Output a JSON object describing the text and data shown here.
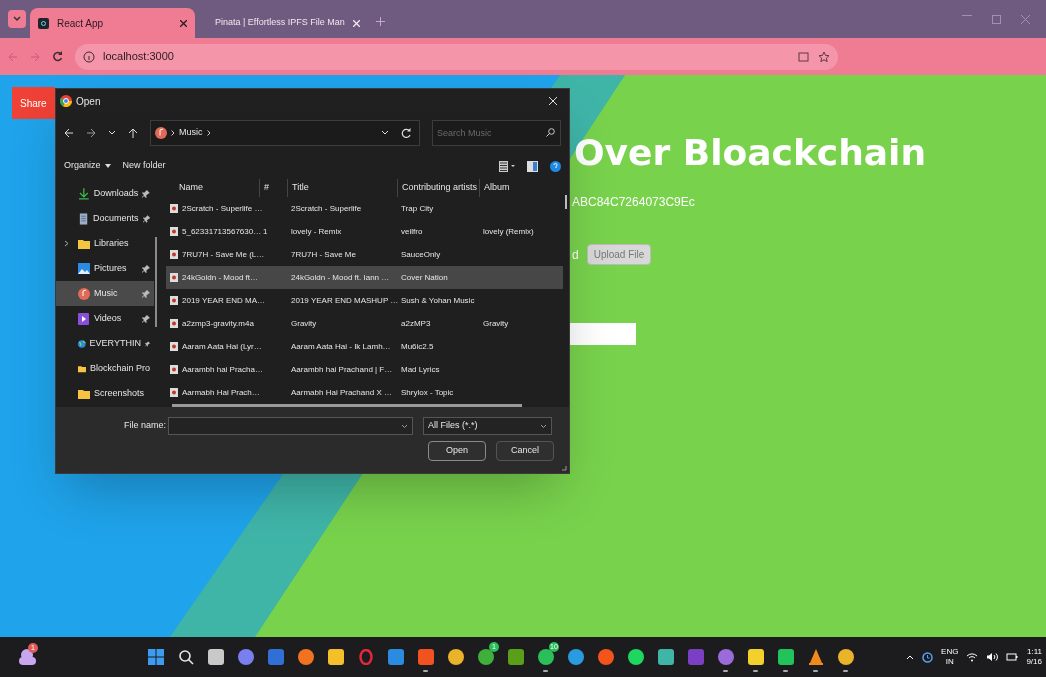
{
  "browser": {
    "tabs": [
      {
        "title": "React App",
        "selected": true
      },
      {
        "title": "Pinata | Effortless IPFS File Man",
        "selected": false
      }
    ],
    "address": "localhost:3000"
  },
  "page": {
    "share_button": "Share",
    "heading": "Over Bloackchain",
    "account": "ABC84C7264073C9Ec",
    "status_text": "d",
    "upload_button": "Upload File"
  },
  "dialog": {
    "title": "Open",
    "breadcrumb": "Music",
    "search_placeholder": "Search Music",
    "organize": "Organize",
    "new_folder": "New folder",
    "nav_items": [
      {
        "label": "Downloads",
        "kind": "download",
        "pinned": true,
        "selected": false
      },
      {
        "label": "Documents",
        "kind": "document",
        "pinned": true,
        "selected": false
      },
      {
        "label": "Libraries",
        "kind": "library",
        "pinned": false,
        "selected": false
      },
      {
        "label": "Pictures",
        "kind": "picture",
        "pinned": true,
        "selected": false
      },
      {
        "label": "Music",
        "kind": "music",
        "pinned": true,
        "selected": true
      },
      {
        "label": "Videos",
        "kind": "video",
        "pinned": true,
        "selected": false
      },
      {
        "label": "EVERYTHIN",
        "kind": "globe",
        "pinned": true,
        "selected": false
      },
      {
        "label": "Blockchain Pro",
        "kind": "folder",
        "pinned": false,
        "selected": false
      },
      {
        "label": "Screenshots",
        "kind": "folder",
        "pinned": false,
        "selected": false
      }
    ],
    "columns": [
      "Name",
      "#",
      "Title",
      "Contributing artists",
      "Album"
    ],
    "rows": [
      {
        "name": "2Scratch - Superlife …",
        "title": "2Scratch - Superlife",
        "artists": "Trap City",
        "selected": false
      },
      {
        "name": "5_62331713567630…",
        "number": "1",
        "title": "lovely - Remix",
        "artists": "veilfro",
        "album": "lovely (Remix)",
        "selected": false
      },
      {
        "name": "7RU7H - Save Me (L…",
        "title": "7RU7H - Save Me",
        "artists": "SauceOnly",
        "selected": false
      },
      {
        "name": "24kGoldn - Mood ft…",
        "title": "24kGoldn - Mood ft. Iann …",
        "artists": "Cover Nation",
        "selected": true
      },
      {
        "name": "2019 YEAR END MA…",
        "title": "2019 YEAR END MASHUP …",
        "artists": "Sush & Yohan Music",
        "selected": false
      },
      {
        "name": "a2zmp3-gravity.m4a",
        "title": "Gravity",
        "artists": "a2zMP3",
        "album": "Gravity",
        "selected": false
      },
      {
        "name": "Aaram Aata Hai (Lyr…",
        "title": "Aaram Aata Hai - Ik Lamh…",
        "artists": "Mu6ic2.5",
        "selected": false
      },
      {
        "name": "Aarambh hai Pracha…",
        "title": "Aarambh hai Prachand | F…",
        "artists": "Mad Lyrics",
        "selected": false
      },
      {
        "name": "Aarmabh Hai Prach…",
        "title": "Aarmabh Hai Prachand X …",
        "artists": "Shrylox - Topic",
        "selected": false
      }
    ],
    "file_name_label": "File name:",
    "file_type": "All Files (*.*)",
    "buttons": [
      "Open",
      "Cancel"
    ]
  },
  "taskbar": {
    "weather_badge": "1",
    "apps": [
      {
        "kind": "start",
        "color": "#3b9cf0",
        "running": false
      },
      {
        "kind": "search",
        "color": "#e5e5e5",
        "running": false
      },
      {
        "kind": "square",
        "color": "#c9c9c9",
        "running": false
      },
      {
        "kind": "circle",
        "color": "#7a7ff0",
        "running": false
      },
      {
        "kind": "square",
        "color": "#2f6fd6",
        "running": false
      },
      {
        "kind": "circle",
        "color": "#f2731f",
        "running": false
      },
      {
        "kind": "square",
        "color": "#f3c02c",
        "running": false
      },
      {
        "kind": "ring",
        "color": "#e0283a",
        "running": false
      },
      {
        "kind": "square",
        "color": "#2a8be0",
        "running": false
      },
      {
        "kind": "square",
        "color": "#f0531f",
        "running": true
      },
      {
        "kind": "circle",
        "color": "#e9b32a",
        "running": false
      },
      {
        "kind": "circle",
        "color": "#3fae3a",
        "running": false,
        "badge": "1"
      },
      {
        "kind": "square",
        "color": "#5a9e1a",
        "running": false
      },
      {
        "kind": "circle",
        "color": "#2bbf5a",
        "running": true,
        "badge": "10"
      },
      {
        "kind": "circle",
        "color": "#2a9be0",
        "running": false
      },
      {
        "kind": "circle",
        "color": "#f2541b",
        "running": false
      },
      {
        "kind": "circle",
        "color": "#1ed760",
        "running": false
      },
      {
        "kind": "square",
        "color": "#3fb5a8",
        "running": false
      },
      {
        "kind": "square",
        "color": "#7b3fc4",
        "running": false
      },
      {
        "kind": "circle",
        "color": "#9b6bd9",
        "running": true
      },
      {
        "kind": "square",
        "color": "#f3d02c",
        "running": true
      },
      {
        "kind": "square",
        "color": "#21c35a",
        "running": true
      },
      {
        "kind": "cone",
        "color": "#f28a1b",
        "running": true
      },
      {
        "kind": "circle",
        "color": "#e9b32a",
        "running": true
      }
    ],
    "language": "ENG",
    "region": "IN",
    "time": "1:11",
    "date": "9/16"
  }
}
